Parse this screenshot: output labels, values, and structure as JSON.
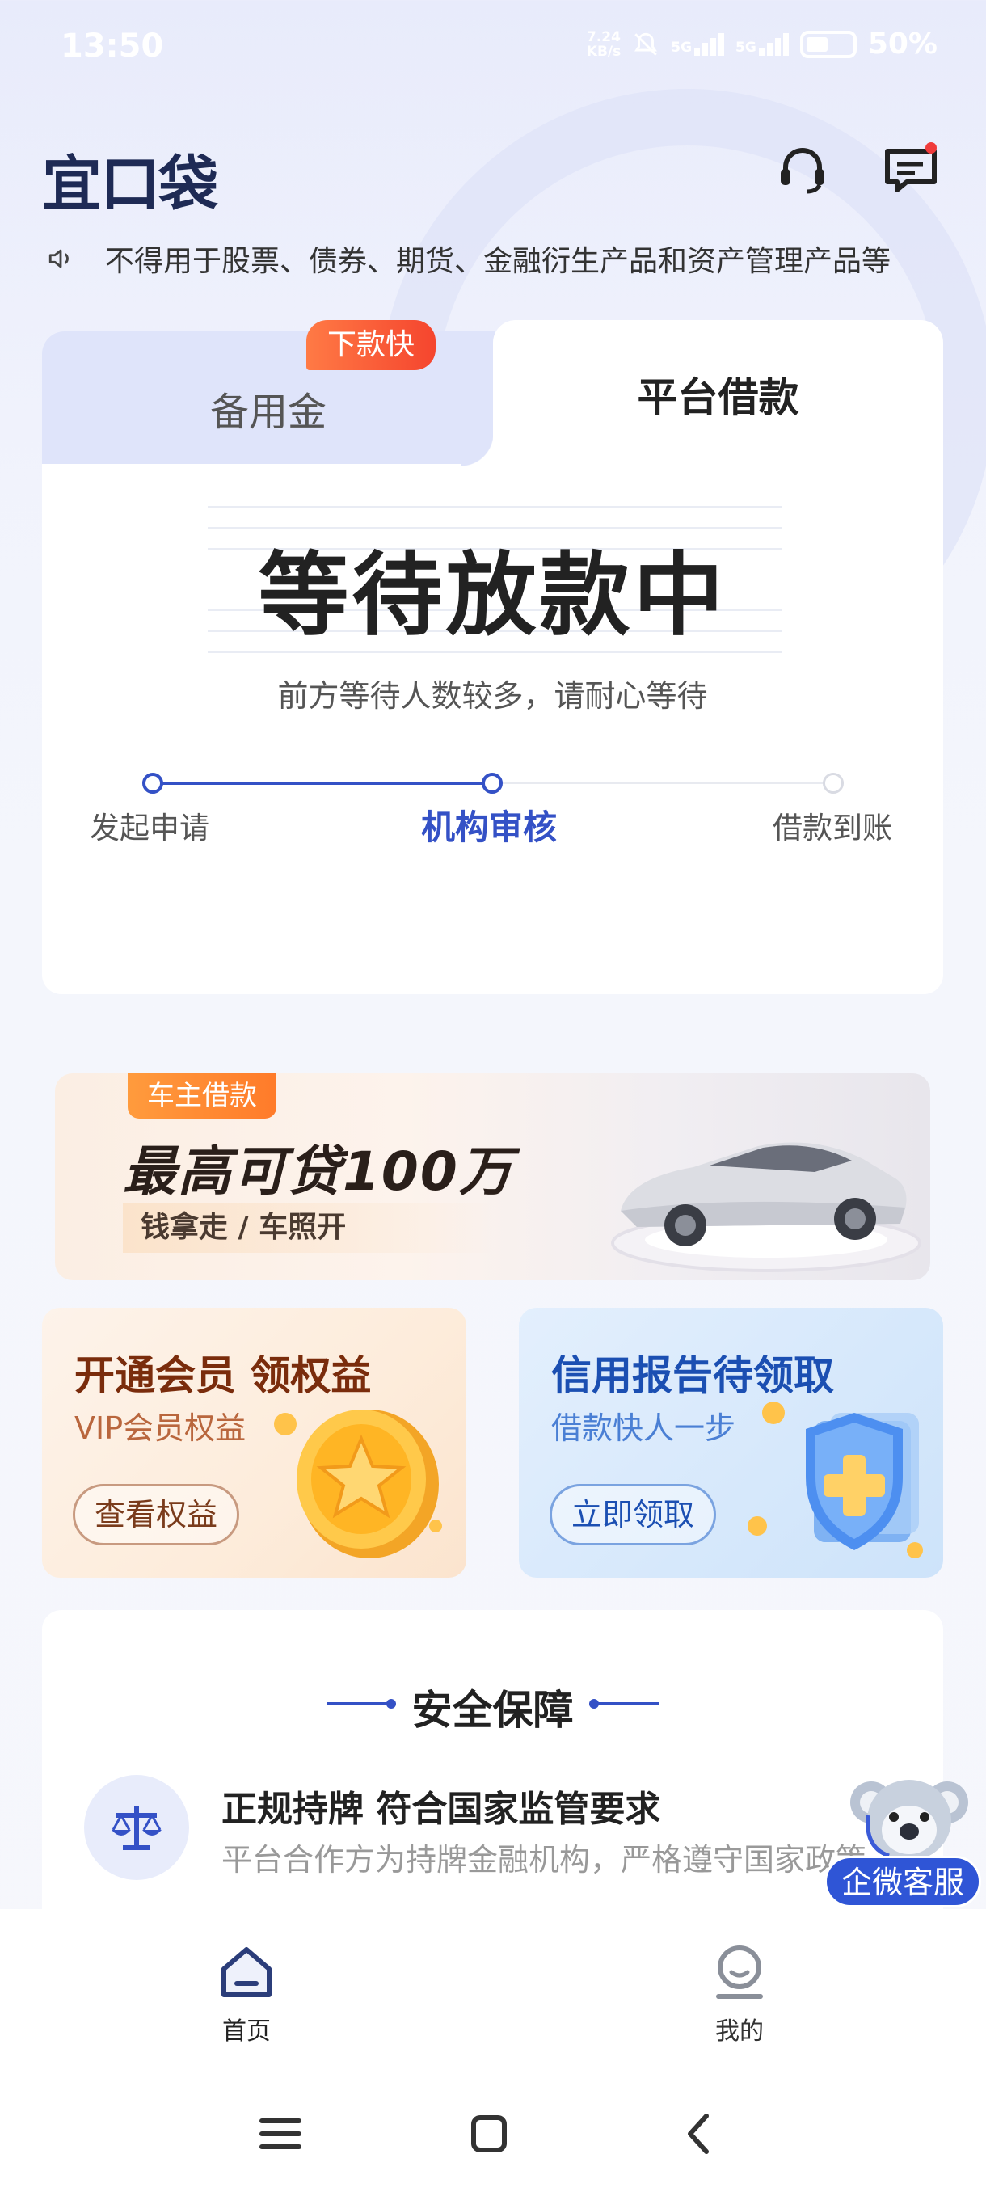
{
  "status_bar": {
    "time": "13:50",
    "net_speed_value": "7.24",
    "net_speed_unit": "KB/s",
    "sim1": "5G",
    "sim2": "5G",
    "battery": "50%"
  },
  "header": {
    "logo": "宜口袋",
    "service_icon": "headset-icon",
    "message_icon": "message-icon"
  },
  "notice": {
    "text": "不得用于股票、债券、期货、金融衍生产品和资产管理产品等"
  },
  "loan_card": {
    "tabs": [
      {
        "label": "备用金",
        "badge": "下款快",
        "active": false
      },
      {
        "label": "平台借款",
        "active": true
      }
    ],
    "status_title": "等待放款中",
    "status_subtitle": "前方等待人数较多，请耐心等待",
    "steps": [
      {
        "label": "发起申请",
        "state": "done"
      },
      {
        "label": "机构审核",
        "state": "current"
      },
      {
        "label": "借款到账",
        "state": "pending"
      }
    ],
    "accent_color": "#3451c6"
  },
  "car_banner": {
    "tag": "车主借款",
    "headline": "最高可贷100万",
    "subline": "钱拿走 / 车照开"
  },
  "promos": {
    "vip": {
      "title": "开通会员 领权益",
      "subtitle": "VIP会员权益",
      "button": "查看权益"
    },
    "credit": {
      "title": "信用报告待领取",
      "subtitle": "借款快人一步",
      "button": "立即领取"
    }
  },
  "security": {
    "title": "安全保障",
    "items": [
      {
        "title": "正规持牌 符合国家监管要求",
        "desc": "平台合作方为持牌金融机构，严格遵守国家政策",
        "icon": "scale-icon"
      }
    ]
  },
  "float_service": {
    "label": "企微客服"
  },
  "bottom_nav": {
    "items": [
      {
        "label": "首页",
        "icon": "home-icon",
        "active": true
      },
      {
        "label": "我的",
        "icon": "profile-icon",
        "active": false
      }
    ]
  },
  "system_nav": {
    "menu": "menu-icon",
    "home": "square-icon",
    "back": "back-icon"
  }
}
